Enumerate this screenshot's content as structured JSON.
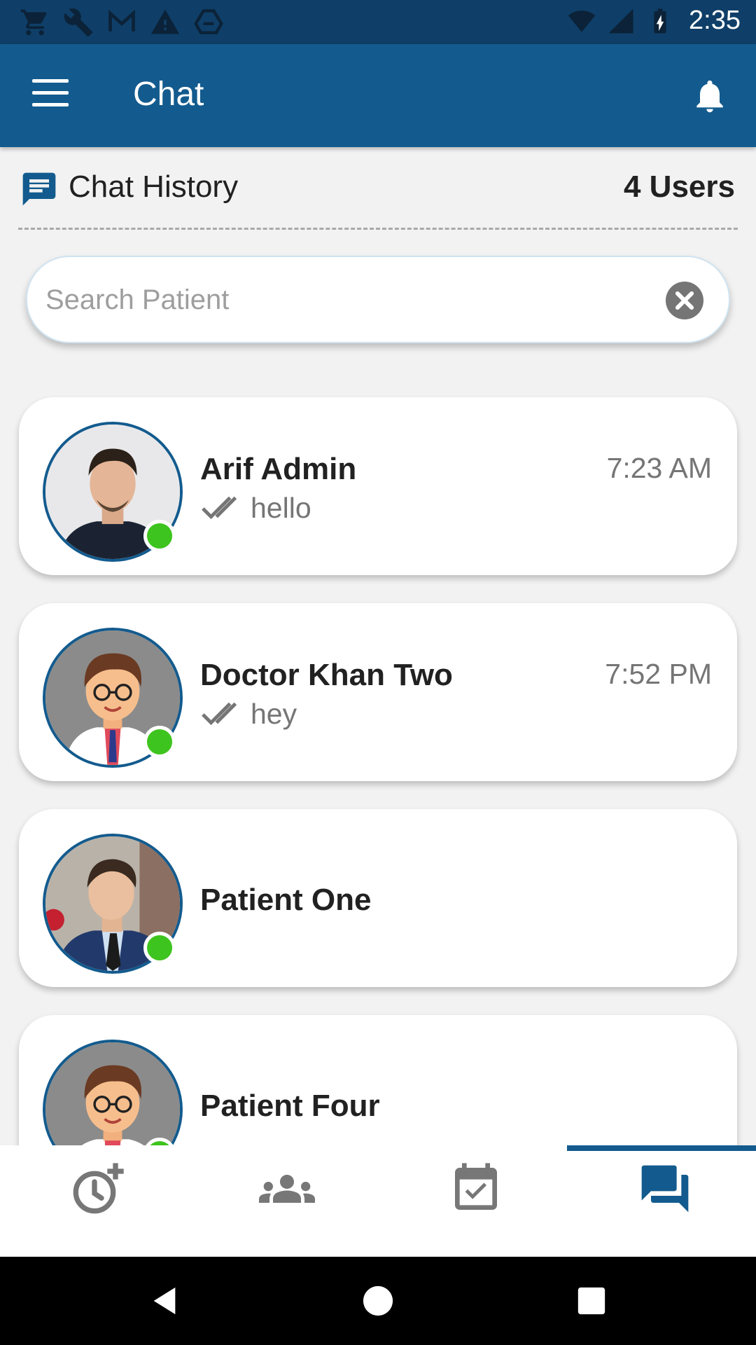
{
  "status_bar": {
    "time": "2:35",
    "left_icons": [
      "cart-icon",
      "wrench-icon",
      "gmail-icon",
      "warning-icon",
      "drive-icon"
    ],
    "right_icons": [
      "wifi-icon",
      "signal-icon",
      "battery-icon"
    ]
  },
  "app_bar": {
    "title": "Chat",
    "menu_icon": "menu-icon",
    "bell_icon": "notification-bell-icon",
    "background": "#135b8e"
  },
  "history": {
    "title": "Chat History",
    "count": "4 Users",
    "icon": "chat-bubble-icon"
  },
  "search": {
    "placeholder": "Search Patient",
    "value": "",
    "clear_icon": "clear-icon"
  },
  "chats": [
    {
      "name": "Arif Admin",
      "time": "7:23 AM",
      "last_message": "hello",
      "online": true,
      "avatar": "photo-man"
    },
    {
      "name": "Doctor Khan Two",
      "time": "7:52 PM",
      "last_message": "hey",
      "online": true,
      "avatar": "cartoon-doctor"
    },
    {
      "name": "Patient One",
      "time": "",
      "last_message": "",
      "online": true,
      "avatar": "photo-man-suit"
    },
    {
      "name": "Patient Four",
      "time": "",
      "last_message": "",
      "online": true,
      "avatar": "cartoon-doctor"
    }
  ],
  "bottom_nav": {
    "items": [
      {
        "icon": "schedule-add-icon",
        "active": false
      },
      {
        "icon": "group-icon",
        "active": false
      },
      {
        "icon": "calendar-check-icon",
        "active": false
      },
      {
        "icon": "chat-forum-icon",
        "active": true
      }
    ],
    "active_color": "#135b8e",
    "inactive_color": "#777777"
  },
  "system_nav": {
    "items": [
      "back-icon",
      "home-icon",
      "recents-icon"
    ]
  },
  "colors": {
    "online": "#3ec41e",
    "primary": "#135b8e",
    "status_bar": "#0f3f68"
  }
}
